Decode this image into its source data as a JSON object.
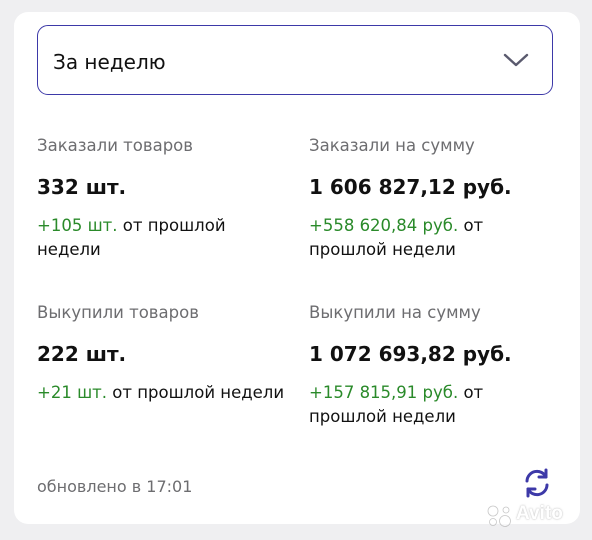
{
  "period_select": {
    "value": "За неделю",
    "icon": "chevron-down-icon",
    "accent_color": "#3d39a8"
  },
  "stats": [
    {
      "label": "Заказали товаров",
      "value": "332 шт.",
      "delta": "+105 шт.",
      "delta_suffix": " от прошлой недели"
    },
    {
      "label": "Заказали на сумму",
      "value": "1 606 827,12 руб.",
      "delta": "+558 620,84 руб.",
      "delta_suffix": " от прошлой недели"
    },
    {
      "label": "Выкупили товаров",
      "value": "222 шт.",
      "delta": "+21 шт.",
      "delta_suffix": " от прошлой недели"
    },
    {
      "label": "Выкупили на сумму",
      "value": "1 072 693,82 руб.",
      "delta": "+157 815,91 руб.",
      "delta_suffix": " от прошлой недели"
    }
  ],
  "footer": {
    "updated_text": "обновлено в 17:01",
    "refresh_icon": "refresh-icon"
  },
  "watermark": {
    "text": "Avito"
  },
  "colors": {
    "positive": "#2a8a2a",
    "label_gray": "#6d6d70",
    "accent": "#3d39a8"
  }
}
